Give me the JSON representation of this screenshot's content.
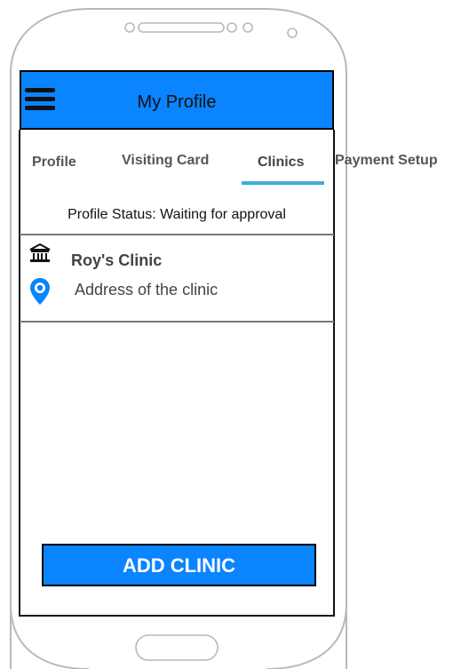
{
  "header": {
    "title": "My Profile",
    "menu_icon": "hamburger-icon"
  },
  "tabs": [
    {
      "label": "Profile",
      "active": false
    },
    {
      "label": "Visiting Card",
      "active": false
    },
    {
      "label": "Clinics",
      "active": true
    },
    {
      "label": "Payment Setup",
      "active": false
    }
  ],
  "status": {
    "text": "Profile Status: Waiting for approval"
  },
  "clinic": {
    "name": "Roy's Clinic",
    "address": "Address of the clinic",
    "building_icon": "bank-building-icon",
    "location_icon": "map-pin-icon"
  },
  "actions": {
    "add_clinic_label": "ADD CLINIC"
  },
  "colors": {
    "primary": "#0a84ff",
    "tab_underline": "#3eaedb"
  }
}
